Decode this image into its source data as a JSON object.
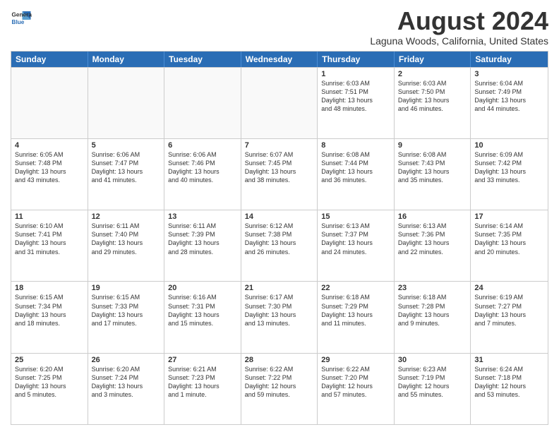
{
  "logo": {
    "line1": "General",
    "line2": "Blue"
  },
  "title": "August 2024",
  "location": "Laguna Woods, California, United States",
  "days_header": [
    "Sunday",
    "Monday",
    "Tuesday",
    "Wednesday",
    "Thursday",
    "Friday",
    "Saturday"
  ],
  "rows": [
    [
      {
        "day": "",
        "info": ""
      },
      {
        "day": "",
        "info": ""
      },
      {
        "day": "",
        "info": ""
      },
      {
        "day": "",
        "info": ""
      },
      {
        "day": "1",
        "info": "Sunrise: 6:03 AM\nSunset: 7:51 PM\nDaylight: 13 hours\nand 48 minutes."
      },
      {
        "day": "2",
        "info": "Sunrise: 6:03 AM\nSunset: 7:50 PM\nDaylight: 13 hours\nand 46 minutes."
      },
      {
        "day": "3",
        "info": "Sunrise: 6:04 AM\nSunset: 7:49 PM\nDaylight: 13 hours\nand 44 minutes."
      }
    ],
    [
      {
        "day": "4",
        "info": "Sunrise: 6:05 AM\nSunset: 7:48 PM\nDaylight: 13 hours\nand 43 minutes."
      },
      {
        "day": "5",
        "info": "Sunrise: 6:06 AM\nSunset: 7:47 PM\nDaylight: 13 hours\nand 41 minutes."
      },
      {
        "day": "6",
        "info": "Sunrise: 6:06 AM\nSunset: 7:46 PM\nDaylight: 13 hours\nand 40 minutes."
      },
      {
        "day": "7",
        "info": "Sunrise: 6:07 AM\nSunset: 7:45 PM\nDaylight: 13 hours\nand 38 minutes."
      },
      {
        "day": "8",
        "info": "Sunrise: 6:08 AM\nSunset: 7:44 PM\nDaylight: 13 hours\nand 36 minutes."
      },
      {
        "day": "9",
        "info": "Sunrise: 6:08 AM\nSunset: 7:43 PM\nDaylight: 13 hours\nand 35 minutes."
      },
      {
        "day": "10",
        "info": "Sunrise: 6:09 AM\nSunset: 7:42 PM\nDaylight: 13 hours\nand 33 minutes."
      }
    ],
    [
      {
        "day": "11",
        "info": "Sunrise: 6:10 AM\nSunset: 7:41 PM\nDaylight: 13 hours\nand 31 minutes."
      },
      {
        "day": "12",
        "info": "Sunrise: 6:11 AM\nSunset: 7:40 PM\nDaylight: 13 hours\nand 29 minutes."
      },
      {
        "day": "13",
        "info": "Sunrise: 6:11 AM\nSunset: 7:39 PM\nDaylight: 13 hours\nand 28 minutes."
      },
      {
        "day": "14",
        "info": "Sunrise: 6:12 AM\nSunset: 7:38 PM\nDaylight: 13 hours\nand 26 minutes."
      },
      {
        "day": "15",
        "info": "Sunrise: 6:13 AM\nSunset: 7:37 PM\nDaylight: 13 hours\nand 24 minutes."
      },
      {
        "day": "16",
        "info": "Sunrise: 6:13 AM\nSunset: 7:36 PM\nDaylight: 13 hours\nand 22 minutes."
      },
      {
        "day": "17",
        "info": "Sunrise: 6:14 AM\nSunset: 7:35 PM\nDaylight: 13 hours\nand 20 minutes."
      }
    ],
    [
      {
        "day": "18",
        "info": "Sunrise: 6:15 AM\nSunset: 7:34 PM\nDaylight: 13 hours\nand 18 minutes."
      },
      {
        "day": "19",
        "info": "Sunrise: 6:15 AM\nSunset: 7:33 PM\nDaylight: 13 hours\nand 17 minutes."
      },
      {
        "day": "20",
        "info": "Sunrise: 6:16 AM\nSunset: 7:31 PM\nDaylight: 13 hours\nand 15 minutes."
      },
      {
        "day": "21",
        "info": "Sunrise: 6:17 AM\nSunset: 7:30 PM\nDaylight: 13 hours\nand 13 minutes."
      },
      {
        "day": "22",
        "info": "Sunrise: 6:18 AM\nSunset: 7:29 PM\nDaylight: 13 hours\nand 11 minutes."
      },
      {
        "day": "23",
        "info": "Sunrise: 6:18 AM\nSunset: 7:28 PM\nDaylight: 13 hours\nand 9 minutes."
      },
      {
        "day": "24",
        "info": "Sunrise: 6:19 AM\nSunset: 7:27 PM\nDaylight: 13 hours\nand 7 minutes."
      }
    ],
    [
      {
        "day": "25",
        "info": "Sunrise: 6:20 AM\nSunset: 7:25 PM\nDaylight: 13 hours\nand 5 minutes."
      },
      {
        "day": "26",
        "info": "Sunrise: 6:20 AM\nSunset: 7:24 PM\nDaylight: 13 hours\nand 3 minutes."
      },
      {
        "day": "27",
        "info": "Sunrise: 6:21 AM\nSunset: 7:23 PM\nDaylight: 13 hours\nand 1 minute."
      },
      {
        "day": "28",
        "info": "Sunrise: 6:22 AM\nSunset: 7:22 PM\nDaylight: 12 hours\nand 59 minutes."
      },
      {
        "day": "29",
        "info": "Sunrise: 6:22 AM\nSunset: 7:20 PM\nDaylight: 12 hours\nand 57 minutes."
      },
      {
        "day": "30",
        "info": "Sunrise: 6:23 AM\nSunset: 7:19 PM\nDaylight: 12 hours\nand 55 minutes."
      },
      {
        "day": "31",
        "info": "Sunrise: 6:24 AM\nSunset: 7:18 PM\nDaylight: 12 hours\nand 53 minutes."
      }
    ]
  ]
}
